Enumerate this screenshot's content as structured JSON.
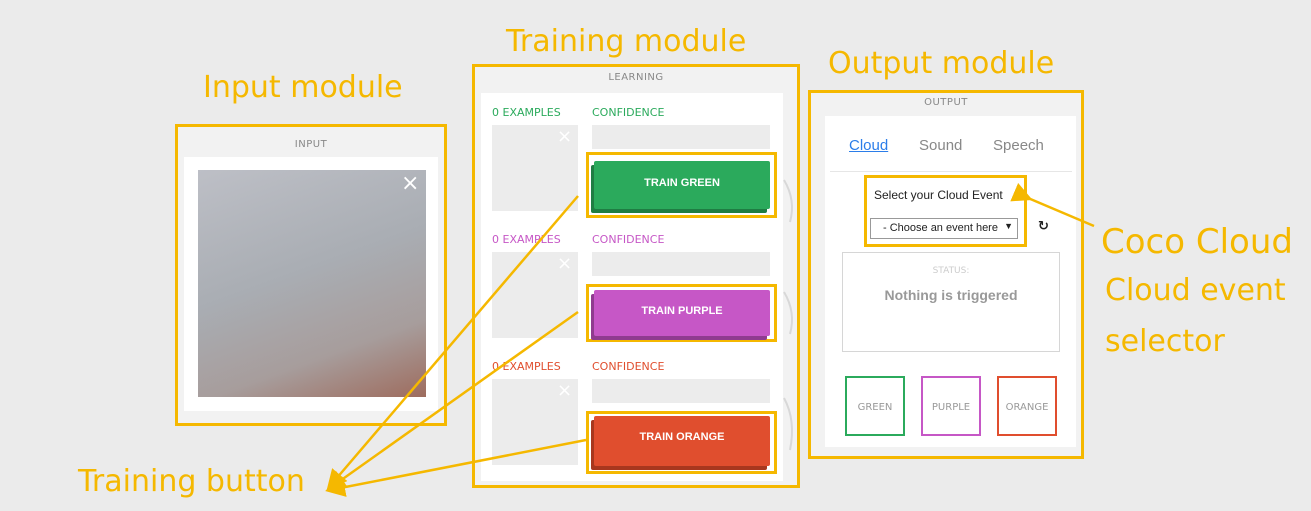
{
  "annotations": {
    "input_module": "Input module",
    "training_module": "Training module",
    "output_module": "Output module",
    "coco_cloud": "Coco Cloud",
    "cloud_event_selector_line1": "Cloud event",
    "cloud_event_selector_line2": "selector",
    "training_button": "Training button",
    "highlight_color": "#f5b800"
  },
  "input": {
    "title": "INPUT",
    "close_icon": "×"
  },
  "learning": {
    "title": "LEARNING",
    "classes": [
      {
        "examples": "0 EXAMPLES",
        "confidence": "CONFIDENCE",
        "button": "TRAIN GREEN",
        "color": "#2baa5c"
      },
      {
        "examples": "0 EXAMPLES",
        "confidence": "CONFIDENCE",
        "button": "TRAIN PURPLE",
        "color": "#c657c6"
      },
      {
        "examples": "0 EXAMPLES",
        "confidence": "CONFIDENCE",
        "button": "TRAIN ORANGE",
        "color": "#e04e2e"
      }
    ],
    "close_icon": "×"
  },
  "output": {
    "title": "OUTPUT",
    "tabs": [
      "Cloud",
      "Sound",
      "Speech"
    ],
    "active_tab": "Cloud",
    "cloud_heading": "Select your Cloud Event",
    "select_value": "- Choose an event here -",
    "refresh_icon": "↻",
    "status_label": "STATUS:",
    "status_value": "Nothing is triggered",
    "boxes": [
      {
        "label": "GREEN",
        "color": "#2baa5c"
      },
      {
        "label": "PURPLE",
        "color": "#c657c6"
      },
      {
        "label": "ORANGE",
        "color": "#e04e2e"
      }
    ]
  }
}
